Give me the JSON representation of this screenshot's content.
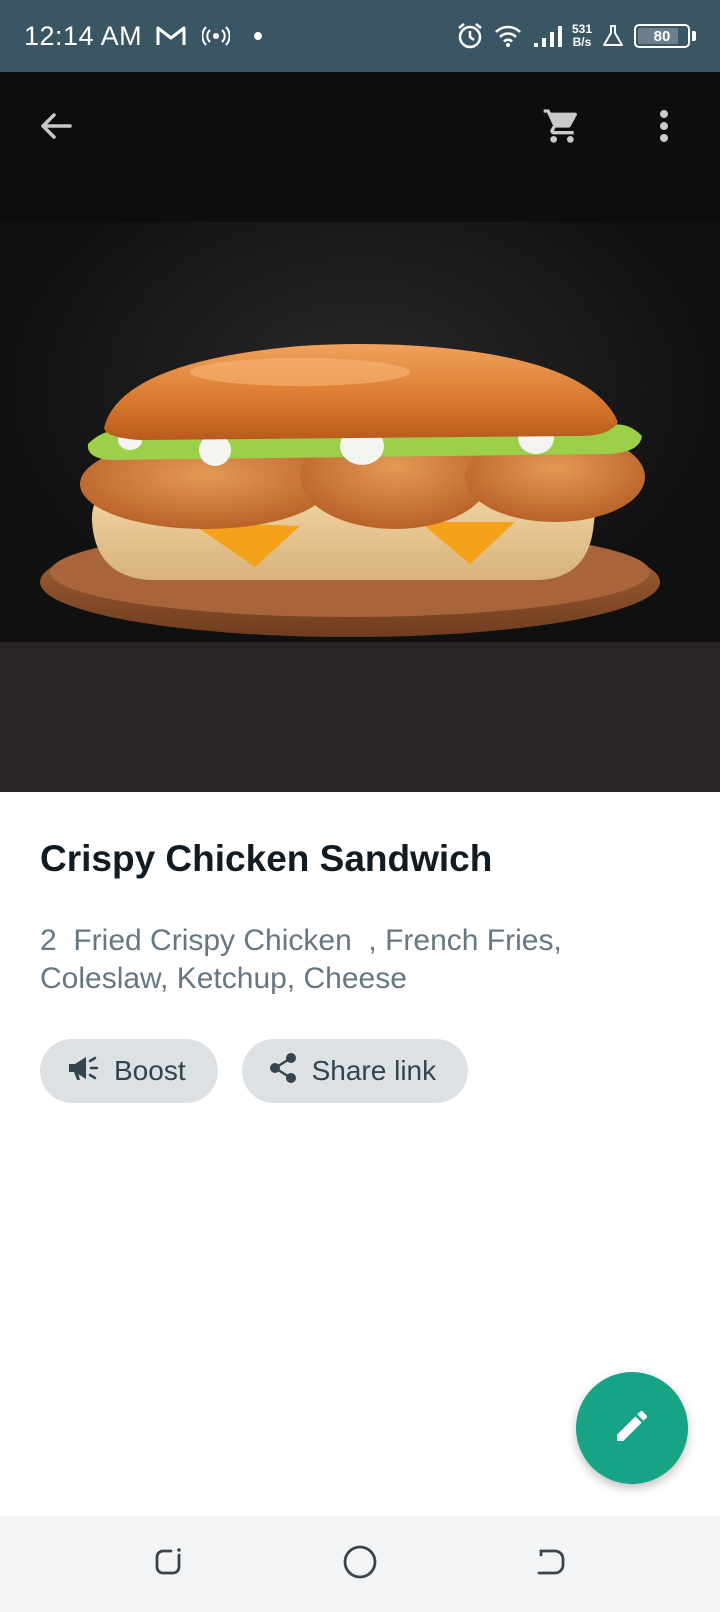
{
  "status_bar": {
    "time": "12:14 AM",
    "net_speed_value": "531",
    "net_speed_unit": "B/s",
    "battery": "80",
    "icons": [
      "gmail-icon",
      "hotspot-icon",
      "dot-icon",
      "alarm-icon",
      "wifi-icon",
      "signal-icon",
      "lab-icon",
      "battery-icon"
    ]
  },
  "app_bar": {
    "back_icon": "arrow-left-icon",
    "cart_icon": "cart-icon",
    "menu_icon": "more-vert-icon"
  },
  "product": {
    "title": "Crispy Chicken Sandwich",
    "description": "2  Fried Crispy Chicken  , French Fries, Coleslaw, Ketchup, Cheese"
  },
  "actions": {
    "boost_label": "Boost",
    "share_label": "Share link"
  },
  "fab": {
    "icon": "pencil-icon"
  },
  "colors": {
    "status_bar": "#3a5563",
    "accent": "#17a385",
    "title": "#111b21",
    "secondary_text": "#667781",
    "pill_bg": "#dde1e3"
  }
}
